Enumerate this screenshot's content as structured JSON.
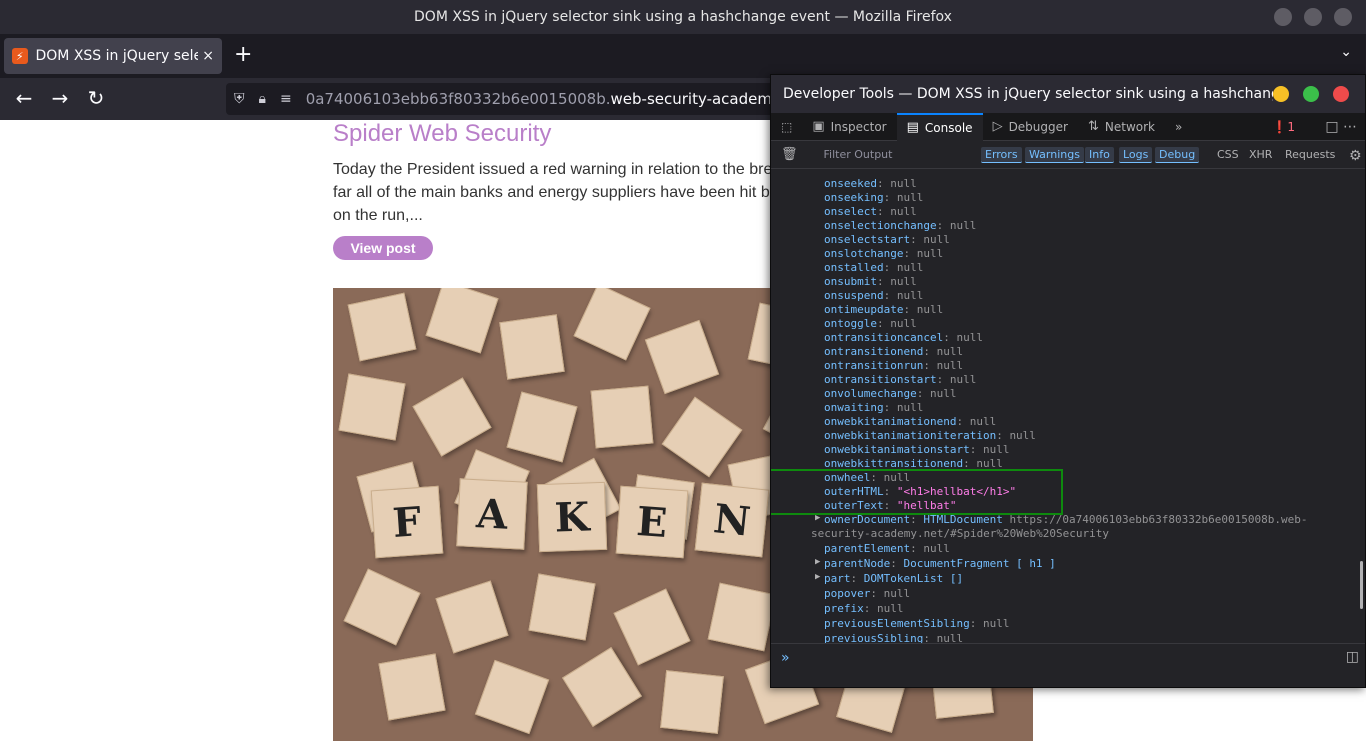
{
  "window": {
    "title": "DOM XSS in jQuery selector sink using a hashchange event — Mozilla Firefox"
  },
  "tab": {
    "label": "DOM XSS in jQuery selector sink using a hashchange event",
    "close": "×",
    "favicon_letter": "⚡"
  },
  "toolbar": {
    "new_tab": "+",
    "back": "←",
    "forward": "→",
    "reload": "↻",
    "list_tabs": "⌄"
  },
  "url": {
    "prefix": "0a74006103ebb63f80332b6e0015008b.",
    "domain": "web-security-academy.net"
  },
  "page": {
    "post_title": "Spider Web Security",
    "post_text_line1": "Today the President issued a red warning in relation to the bre",
    "post_text_line2": "far all of the main banks and energy suppliers have been hit b",
    "post_text_line3": "on the run,...",
    "view_post": "View post",
    "tile_letters": [
      "F",
      "A",
      "K",
      "E",
      "N"
    ]
  },
  "devtools": {
    "title": "Developer Tools — DOM XSS in jQuery selector sink using a hashchang…",
    "tabs": [
      "Inspector",
      "Console",
      "Debugger",
      "Network"
    ],
    "error_count": "1",
    "filter_placeholder": "Filter Output",
    "filters": [
      "Errors",
      "Warnings",
      "Info",
      "Logs",
      "Debug",
      "CSS",
      "XHR",
      "Requests"
    ],
    "properties": [
      {
        "key": "onseeked",
        "value": "null"
      },
      {
        "key": "onseeking",
        "value": "null"
      },
      {
        "key": "onselect",
        "value": "null"
      },
      {
        "key": "onselectionchange",
        "value": "null"
      },
      {
        "key": "onselectstart",
        "value": "null"
      },
      {
        "key": "onslotchange",
        "value": "null"
      },
      {
        "key": "onstalled",
        "value": "null"
      },
      {
        "key": "onsubmit",
        "value": "null"
      },
      {
        "key": "onsuspend",
        "value": "null"
      },
      {
        "key": "ontimeupdate",
        "value": "null"
      },
      {
        "key": "ontoggle",
        "value": "null"
      },
      {
        "key": "ontransitioncancel",
        "value": "null"
      },
      {
        "key": "ontransitionend",
        "value": "null"
      },
      {
        "key": "ontransitionrun",
        "value": "null"
      },
      {
        "key": "ontransitionstart",
        "value": "null"
      },
      {
        "key": "onvolumechange",
        "value": "null"
      },
      {
        "key": "onwaiting",
        "value": "null"
      },
      {
        "key": "onwebkitanimationend",
        "value": "null"
      },
      {
        "key": "onwebkitanimationiteration",
        "value": "null"
      },
      {
        "key": "onwebkitanimationstart",
        "value": "null"
      },
      {
        "key": "onwebkittransitionend",
        "value": "null"
      },
      {
        "key": "onwheel",
        "value": "null"
      },
      {
        "key": "outerHTML",
        "value": "\"<h1>hellbat</h1>\""
      },
      {
        "key": "outerText",
        "value": "\"hellbat\""
      }
    ],
    "owner_document": {
      "key": "ownerDocument",
      "type": "HTMLDocument",
      "url1": "https://0a74006103ebb63f80332b6e0015008b.web-",
      "url2": "security-academy.net/#Spider%20Web%20Security"
    },
    "props2": [
      {
        "key": "parentElement",
        "value": "null",
        "expandable": false
      },
      {
        "key": "parentNode",
        "value": "DocumentFragment [ h1 ]",
        "expandable": true
      },
      {
        "key": "part",
        "value": "DOMTokenList []",
        "expandable": true
      },
      {
        "key": "popover",
        "value": "null",
        "expandable": false
      },
      {
        "key": "prefix",
        "value": "null",
        "expandable": false
      },
      {
        "key": "previousElementSibling",
        "value": "null",
        "expandable": false
      },
      {
        "key": "previousSibling",
        "value": "null",
        "expandable": false
      }
    ],
    "prompt": "»"
  }
}
